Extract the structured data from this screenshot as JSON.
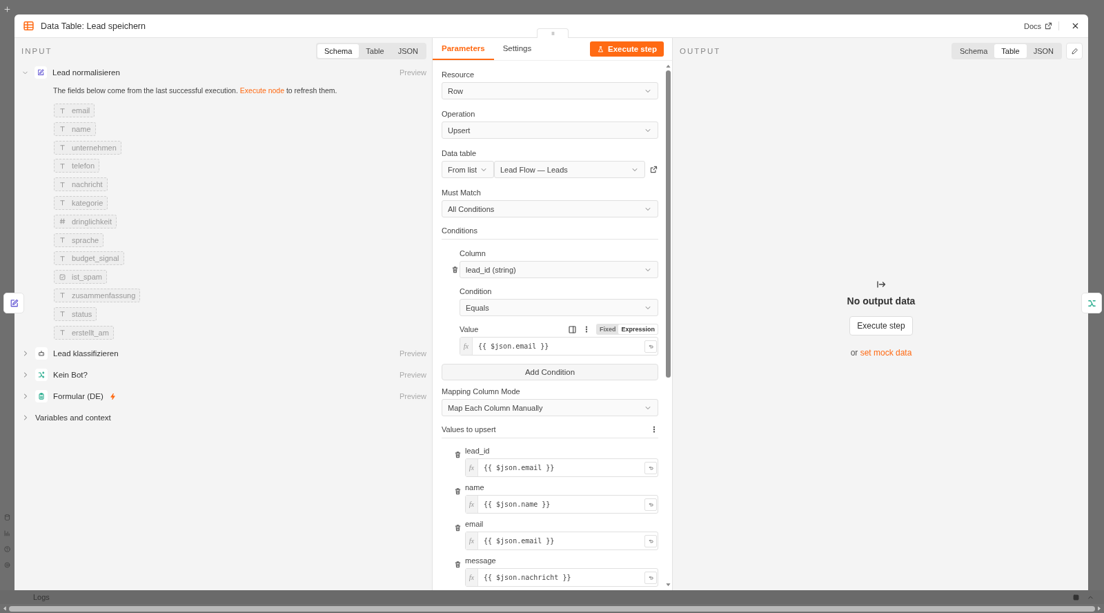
{
  "window": {
    "title": "Data Table: Lead speichern",
    "docs": "Docs"
  },
  "input": {
    "title": "INPUT",
    "views": [
      {
        "label": "Schema",
        "selected": true
      },
      {
        "label": "Table",
        "selected": false
      },
      {
        "label": "JSON",
        "selected": false
      }
    ],
    "nodes": [
      {
        "name": "Lead normalisieren",
        "kind": "edit",
        "expanded": true,
        "trigger": false,
        "preview": "Preview",
        "notice": {
          "before": "The fields below come from the last successful execution.",
          "link": "Execute node",
          "after": "to refresh them."
        },
        "fields": [
          {
            "kind": "string",
            "name": "email"
          },
          {
            "kind": "string",
            "name": "name"
          },
          {
            "kind": "string",
            "name": "unternehmen"
          },
          {
            "kind": "string",
            "name": "telefon"
          },
          {
            "kind": "string",
            "name": "nachricht"
          },
          {
            "kind": "string",
            "name": "kategorie"
          },
          {
            "kind": "number",
            "name": "dringlichkeit"
          },
          {
            "kind": "string",
            "name": "sprache"
          },
          {
            "kind": "string",
            "name": "budget_signal"
          },
          {
            "kind": "boolean",
            "name": "ist_spam"
          },
          {
            "kind": "string",
            "name": "zusammenfassung"
          },
          {
            "kind": "string",
            "name": "status"
          },
          {
            "kind": "string",
            "name": "erstellt_am"
          }
        ]
      },
      {
        "name": "Lead klassifizieren",
        "kind": "robot",
        "expanded": false,
        "trigger": false,
        "preview": "Preview"
      },
      {
        "name": "Kein Bot?",
        "kind": "branch",
        "expanded": false,
        "trigger": false,
        "preview": "Preview"
      },
      {
        "name": "Formular (DE)",
        "kind": "form",
        "expanded": false,
        "trigger": true,
        "preview": "Preview"
      }
    ],
    "context": {
      "label": "Variables and context",
      "expanded": false
    }
  },
  "parameters": {
    "tabs": [
      {
        "label": "Parameters",
        "selected": true
      },
      {
        "label": "Settings",
        "selected": false
      }
    ],
    "execute_button": "Execute step",
    "resource": {
      "label": "Resource",
      "value": "Row"
    },
    "operation": {
      "label": "Operation",
      "value": "Upsert"
    },
    "data_table": {
      "label": "Data table",
      "mode": "From list",
      "value": "Lead Flow — Leads"
    },
    "must_match": {
      "label": "Must Match",
      "value": "All Conditions"
    },
    "conditions": {
      "label": "Conditions",
      "items": [
        {
          "column_label": "Column",
          "column": "lead_id (string)",
          "condition_label": "Condition",
          "condition": "Equals",
          "value_label": "Value",
          "modes": [
            {
              "label": "Fixed",
              "selected": false
            },
            {
              "label": "Expression",
              "selected": true
            }
          ],
          "prefix": "fx",
          "value": "{{ $json.email }}"
        }
      ],
      "add_button": "Add Condition"
    },
    "mapping_mode": {
      "label": "Mapping Column Mode",
      "value": "Map Each Column Manually"
    },
    "values": {
      "label": "Values to upsert",
      "items": [
        {
          "name": "lead_id",
          "prefix": "fx",
          "value": "{{ $json.email }}"
        },
        {
          "name": "name",
          "prefix": "fx",
          "value": "{{ $json.name }}"
        },
        {
          "name": "email",
          "prefix": "fx",
          "value": "{{ $json.email }}"
        },
        {
          "name": "message",
          "prefix": "fx",
          "value": "{{ $json.nachricht }}"
        }
      ]
    }
  },
  "output": {
    "title": "OUTPUT",
    "views": [
      {
        "label": "Schema",
        "selected": false
      },
      {
        "label": "Table",
        "selected": true
      },
      {
        "label": "JSON",
        "selected": false
      }
    ],
    "empty_title": "No output data",
    "execute_button": "Execute step",
    "mock_prefix": "or",
    "mock_link": "set mock data"
  },
  "logs": {
    "label": "Logs"
  }
}
